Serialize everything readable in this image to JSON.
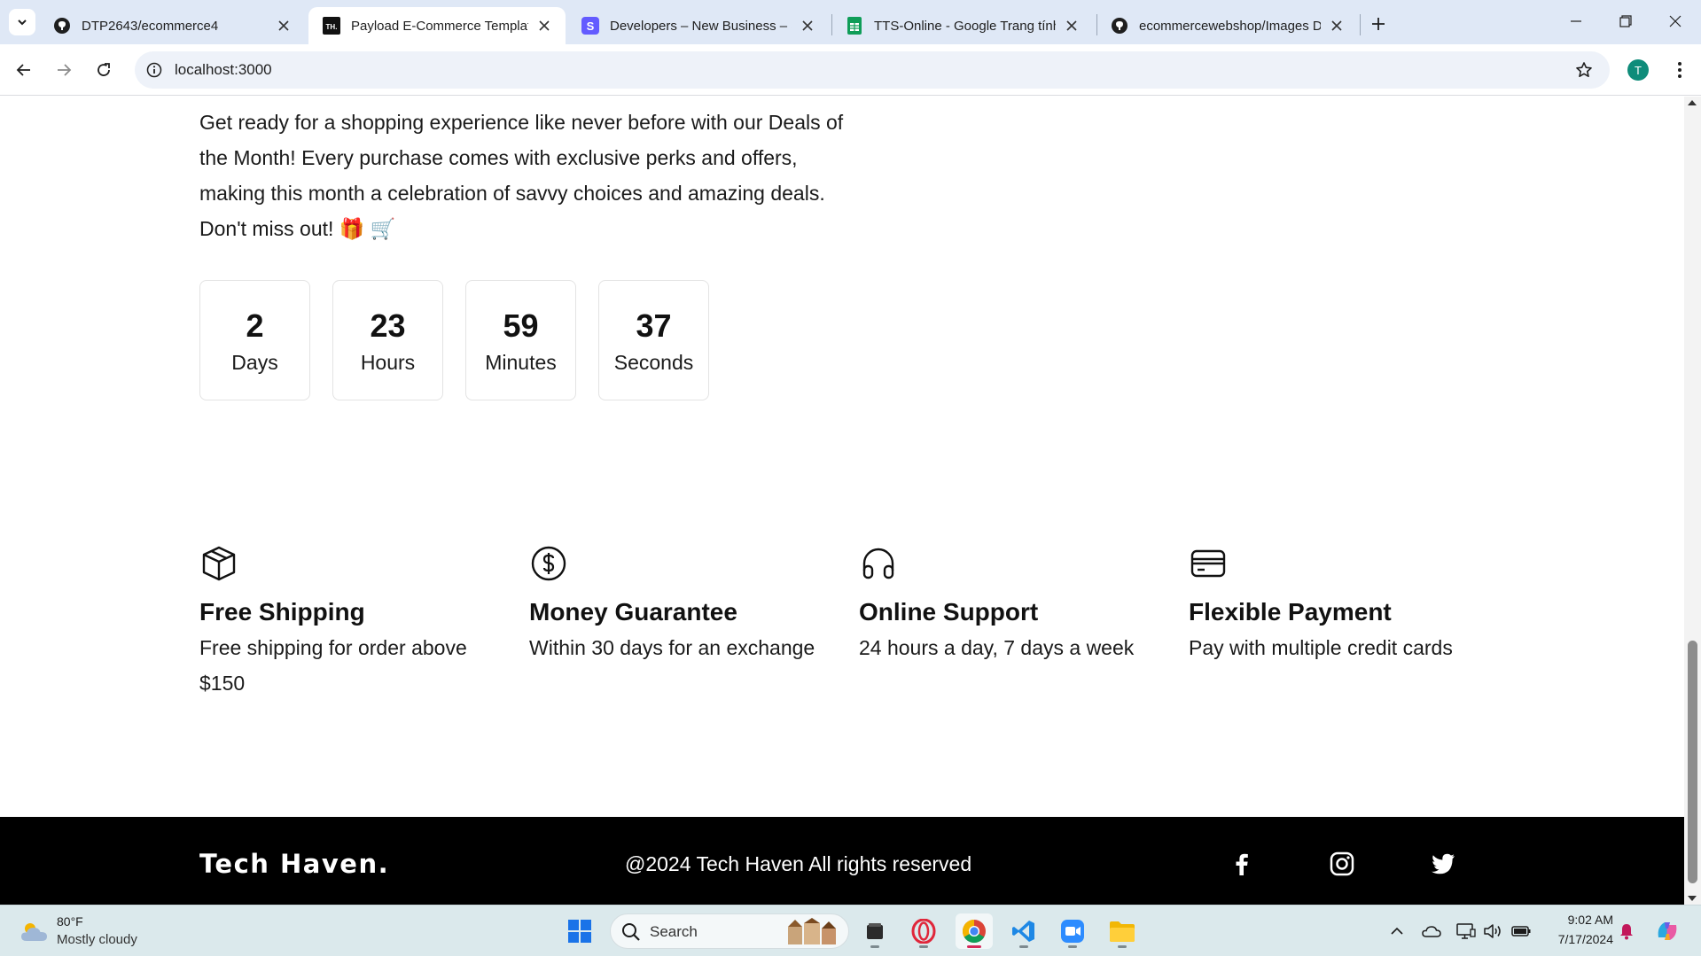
{
  "browser": {
    "tabs": [
      {
        "title": "DTP2643/ecommerce4",
        "favicon": "github-icon"
      },
      {
        "title": "Payload E-Commerce Template",
        "favicon": "th-logo-icon"
      },
      {
        "title": "Developers – New Business – St",
        "favicon": "stripe-icon"
      },
      {
        "title": "TTS-Online - Google Trang tính",
        "favicon": "google-sheets-icon"
      },
      {
        "title": "ecommercewebshop/Images D",
        "favicon": "github-icon"
      }
    ],
    "active_tab_index": 1,
    "favicon_th_text": "TH.",
    "url": "localhost:3000",
    "profile_initial": "T"
  },
  "promo": {
    "text": "Get ready for a shopping experience like never before with our Deals of the Month! Every purchase comes with exclusive perks and offers, making this month a celebration of savvy choices and amazing deals. Don't miss out! 🎁 🛒"
  },
  "countdown": [
    {
      "value": "2",
      "unit": "Days"
    },
    {
      "value": "23",
      "unit": "Hours"
    },
    {
      "value": "59",
      "unit": "Minutes"
    },
    {
      "value": "37",
      "unit": "Seconds"
    }
  ],
  "features": [
    {
      "icon": "box-icon",
      "title": "Free Shipping",
      "desc": "Free shipping for order above $150"
    },
    {
      "icon": "dollar-circle-icon",
      "title": "Money Guarantee",
      "desc": "Within 30 days for an exchange"
    },
    {
      "icon": "headphones-icon",
      "title": "Online Support",
      "desc": "24 hours a day, 7 days a week"
    },
    {
      "icon": "credit-card-icon",
      "title": "Flexible Payment",
      "desc": "Pay with multiple credit cards"
    }
  ],
  "footer": {
    "brand": "Tech Haven.",
    "copyright": "@2024 Tech Haven All rights reserved",
    "social": [
      "facebook-icon",
      "instagram-icon",
      "twitter-icon"
    ]
  },
  "taskbar": {
    "weather_temp": "80°F",
    "weather_desc": "Mostly cloudy",
    "search_placeholder": "Search",
    "time": "9:02 AM",
    "date": "7/17/2024",
    "apps": [
      "windows-start-icon",
      "file-explorer-dark-icon",
      "opera-icon",
      "chrome-icon",
      "vscode-icon",
      "zoom-icon",
      "folder-icon"
    ],
    "active_app": "chrome-icon"
  },
  "colors": {
    "accent_profile": "#0f8c7a",
    "footer_bg": "#000000",
    "tabstrip_bg": "#dfe8f6",
    "taskbar_bg": "#dbe9ec"
  }
}
